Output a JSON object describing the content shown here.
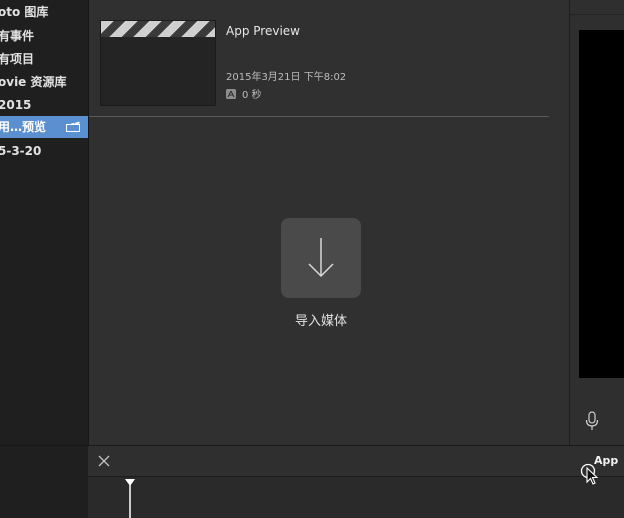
{
  "sidebar": {
    "items": [
      {
        "label": "oto 图库",
        "selected": false
      },
      {
        "label": "有事件",
        "selected": false
      },
      {
        "label": "有项目",
        "selected": false
      },
      {
        "label": "ovie 资源库",
        "selected": false
      },
      {
        "label": "2015",
        "selected": false
      },
      {
        "label": "用…预览",
        "selected": true
      },
      {
        "label": "5-3-20",
        "selected": false
      }
    ],
    "selected_icon": "clapperboard-icon"
  },
  "browser": {
    "clip": {
      "title": "App Preview",
      "date": "2015年3月21日 下午8:02",
      "duration": "0 秒"
    },
    "import_label": "导入媒体"
  },
  "timeline": {
    "project_label": "App"
  },
  "colors": {
    "selection": "#5a8fd0",
    "background": "#303030",
    "viewer": "#000000"
  }
}
